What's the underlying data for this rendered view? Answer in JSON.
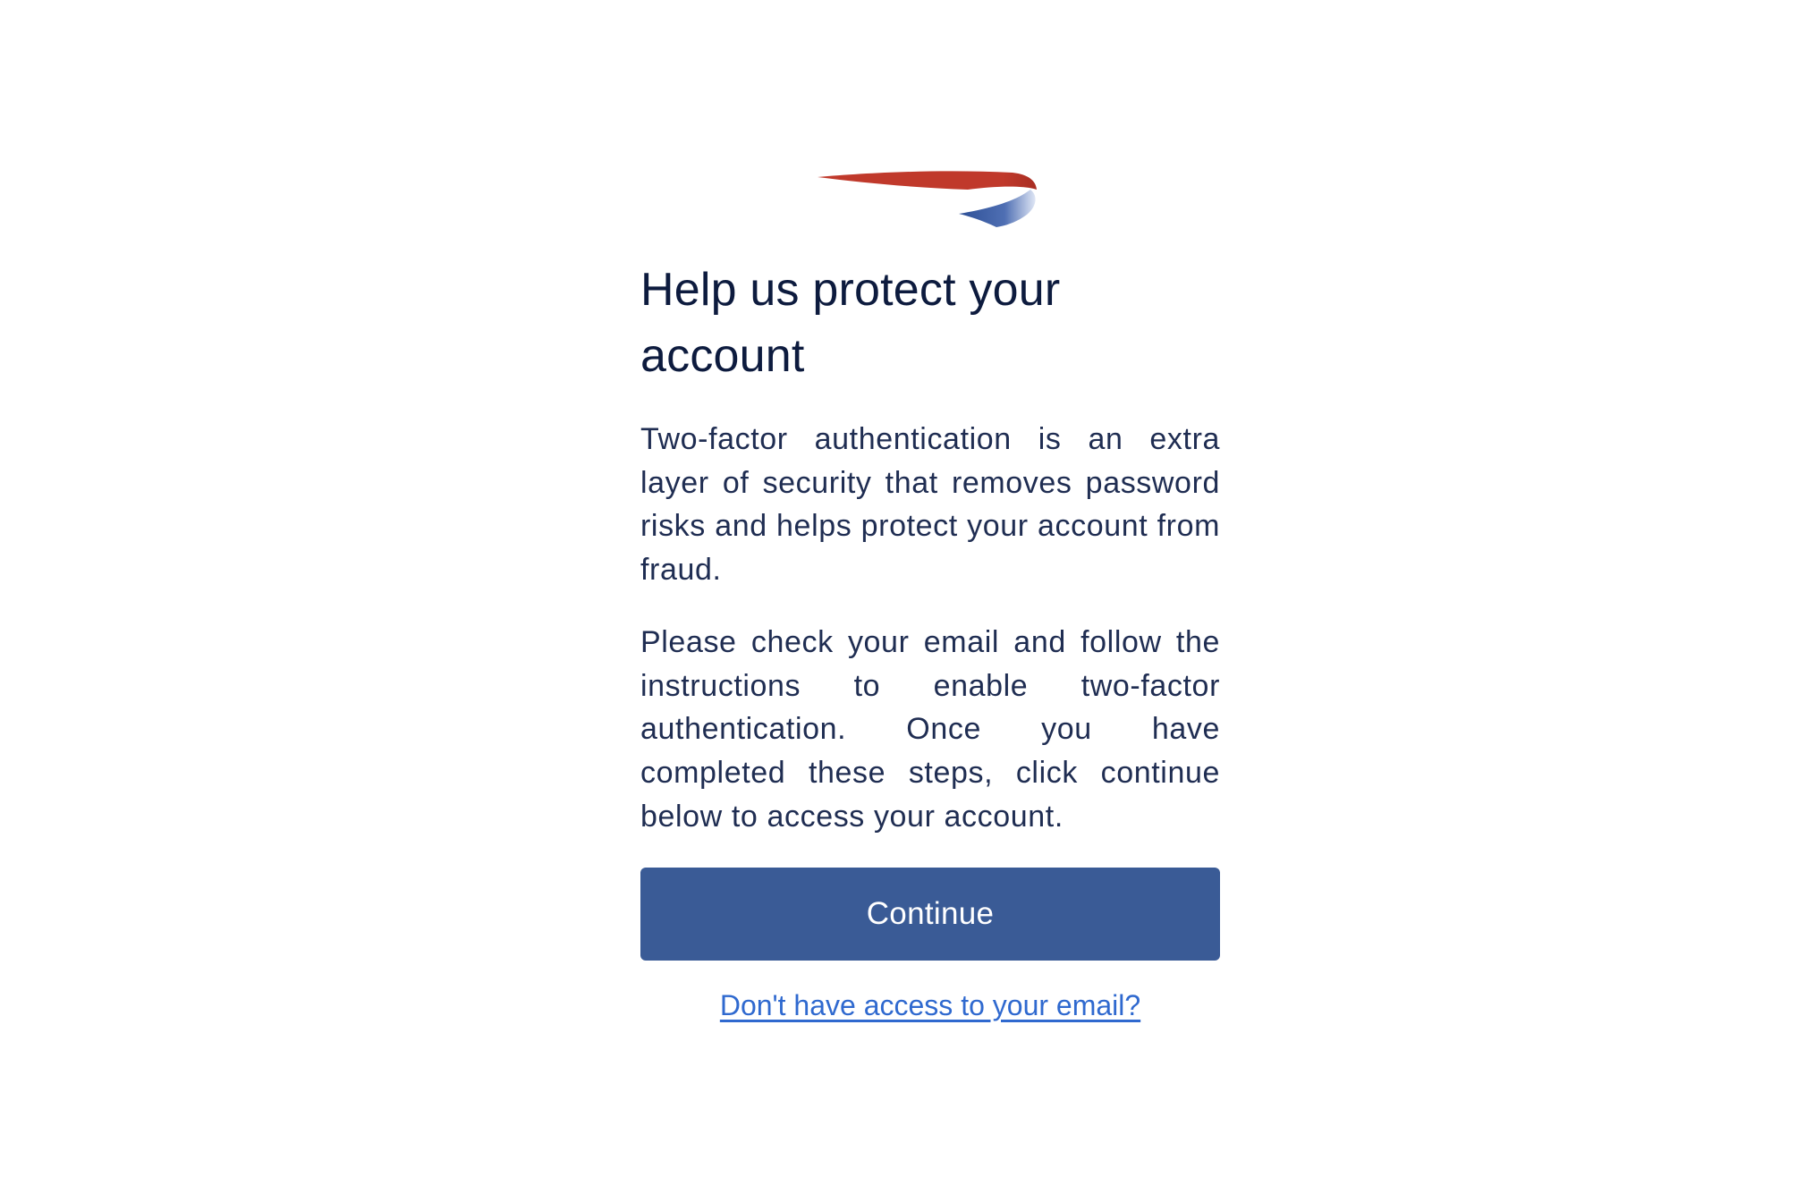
{
  "brand": {
    "logo_icon": "speedmarque-icon",
    "colors": {
      "red": "#c0392b",
      "blue": "#3a5b96"
    }
  },
  "page": {
    "title": "Help us protect your account",
    "paragraph1": "Two-factor authentication is an extra layer of security that removes password risks and helps protect your account from fraud.",
    "paragraph2": "Please check your email and follow the instructions to enable two-factor authentication. Once you have completed these steps, click continue below to access your account."
  },
  "actions": {
    "continue_label": "Continue",
    "no_email_link": "Don't have access to your email?"
  }
}
